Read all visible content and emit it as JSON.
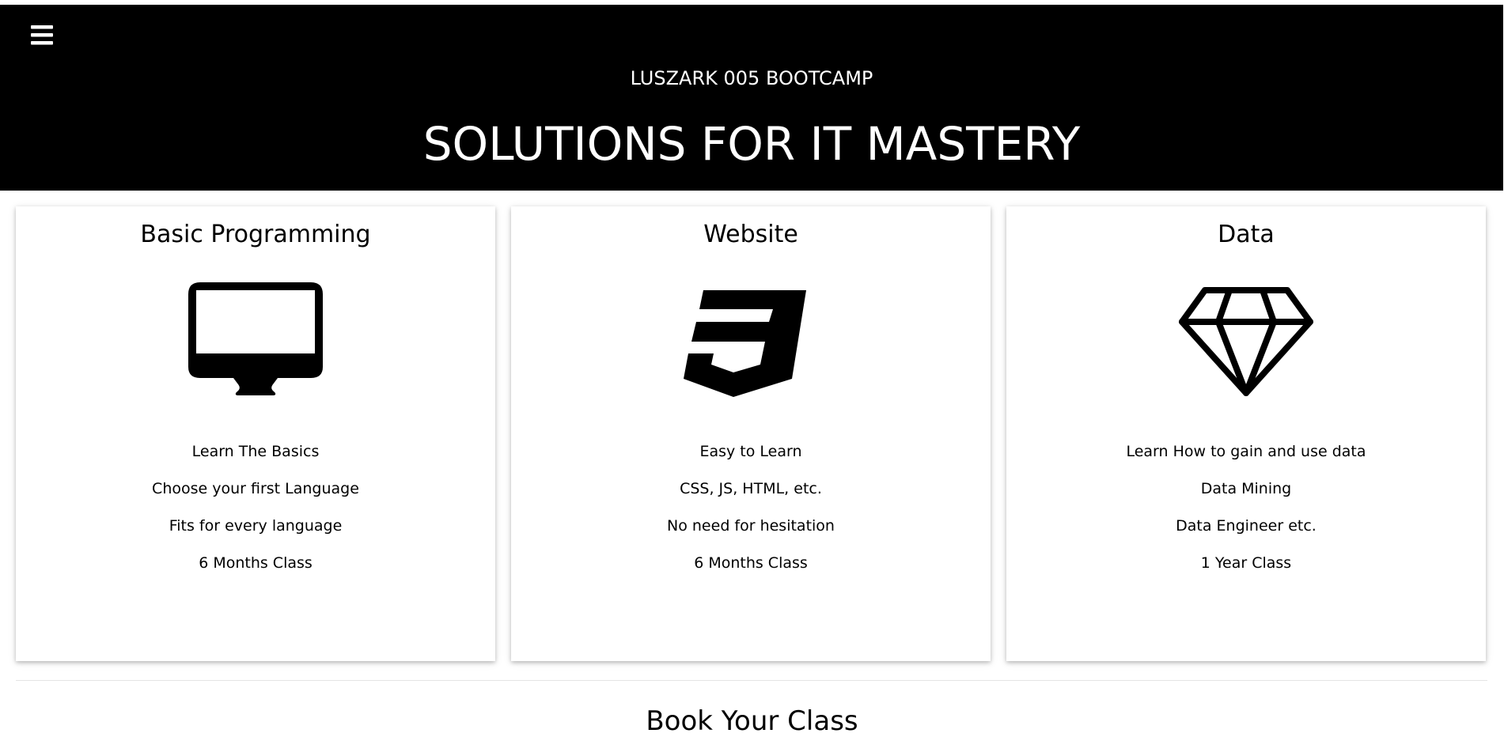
{
  "header": {
    "menu_icon": "hamburger-menu-icon",
    "subtitle": "LUSZARK 005 BOOTCAMP",
    "title": "SOLUTIONS FOR IT MASTERY",
    "background": "#000000",
    "text_color": "#ffffff"
  },
  "cards": [
    {
      "title": "Basic Programming",
      "icon": "desktop-monitor-icon",
      "items": [
        "Learn The Basics",
        "Choose your first Language",
        "Fits for every language",
        "6 Months Class"
      ]
    },
    {
      "title": "Website",
      "icon": "css3-icon",
      "items": [
        "Easy to Learn",
        "CSS, JS, HTML, etc.",
        "No need for hesitation",
        "6 Months Class"
      ]
    },
    {
      "title": "Data",
      "icon": "diamond-icon",
      "items": [
        "Learn How to gain and use data",
        "Data Mining",
        "Data Engineer etc.",
        "1 Year Class"
      ]
    }
  ],
  "booking": {
    "title": "Book Your Class"
  }
}
